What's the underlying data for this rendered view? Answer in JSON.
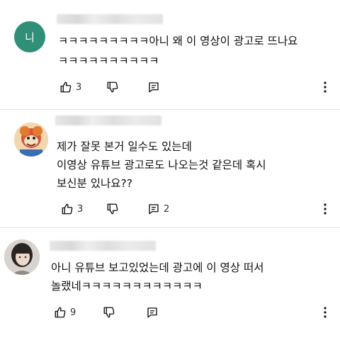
{
  "comments": [
    {
      "avatar_letter": "니",
      "avatar_color": "#2f8f77",
      "lines": [
        "ㅋㅋㅋㅋㅋㅋㅋㅋㅋ아니 왜 이 영상이 광고로 뜨나요",
        "ㅋㅋㅋㅋㅋㅋㅋㅋㅋㅋ"
      ],
      "likes": "3",
      "replies": ""
    },
    {
      "avatar_letter": "",
      "avatar_color": "#d9543a",
      "lines": [
        "제가 잘못 본거 일수도 있는데",
        "이영상 유튜브 광고로도 나오는것 같은데 혹시",
        "보신분 있나요??"
      ],
      "likes": "3",
      "replies": "2"
    },
    {
      "avatar_letter": "",
      "avatar_color": "#8a8580",
      "lines": [
        "아니 유튜브 보고있었는데 광고에 이 영상 떠서",
        "놀랬네ㅋㅋㅋㅋㅋㅋㅋㅋㅋㅋㅋㅋ"
      ],
      "likes": "9",
      "replies": ""
    }
  ],
  "icons": {
    "like": "thumbs-up-icon",
    "dislike": "thumbs-down-icon",
    "reply": "reply-icon",
    "more": "more-vertical-icon"
  }
}
